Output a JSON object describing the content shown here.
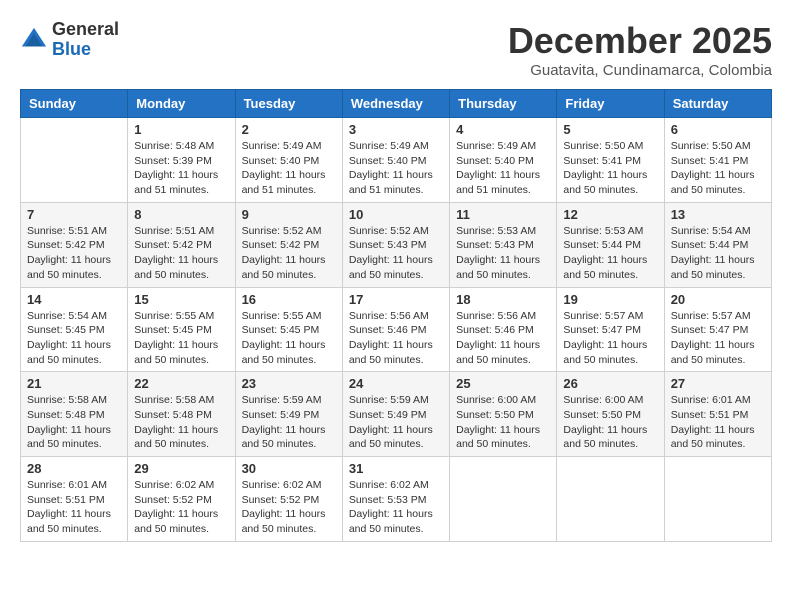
{
  "logo": {
    "general": "General",
    "blue": "Blue"
  },
  "title": "December 2025",
  "location": "Guatavita, Cundinamarca, Colombia",
  "weekdays": [
    "Sunday",
    "Monday",
    "Tuesday",
    "Wednesday",
    "Thursday",
    "Friday",
    "Saturday"
  ],
  "weeks": [
    [
      {
        "day": "",
        "info": ""
      },
      {
        "day": "1",
        "info": "Sunrise: 5:48 AM\nSunset: 5:39 PM\nDaylight: 11 hours\nand 51 minutes."
      },
      {
        "day": "2",
        "info": "Sunrise: 5:49 AM\nSunset: 5:40 PM\nDaylight: 11 hours\nand 51 minutes."
      },
      {
        "day": "3",
        "info": "Sunrise: 5:49 AM\nSunset: 5:40 PM\nDaylight: 11 hours\nand 51 minutes."
      },
      {
        "day": "4",
        "info": "Sunrise: 5:49 AM\nSunset: 5:40 PM\nDaylight: 11 hours\nand 51 minutes."
      },
      {
        "day": "5",
        "info": "Sunrise: 5:50 AM\nSunset: 5:41 PM\nDaylight: 11 hours\nand 50 minutes."
      },
      {
        "day": "6",
        "info": "Sunrise: 5:50 AM\nSunset: 5:41 PM\nDaylight: 11 hours\nand 50 minutes."
      }
    ],
    [
      {
        "day": "7",
        "info": "Sunrise: 5:51 AM\nSunset: 5:42 PM\nDaylight: 11 hours\nand 50 minutes."
      },
      {
        "day": "8",
        "info": "Sunrise: 5:51 AM\nSunset: 5:42 PM\nDaylight: 11 hours\nand 50 minutes."
      },
      {
        "day": "9",
        "info": "Sunrise: 5:52 AM\nSunset: 5:42 PM\nDaylight: 11 hours\nand 50 minutes."
      },
      {
        "day": "10",
        "info": "Sunrise: 5:52 AM\nSunset: 5:43 PM\nDaylight: 11 hours\nand 50 minutes."
      },
      {
        "day": "11",
        "info": "Sunrise: 5:53 AM\nSunset: 5:43 PM\nDaylight: 11 hours\nand 50 minutes."
      },
      {
        "day": "12",
        "info": "Sunrise: 5:53 AM\nSunset: 5:44 PM\nDaylight: 11 hours\nand 50 minutes."
      },
      {
        "day": "13",
        "info": "Sunrise: 5:54 AM\nSunset: 5:44 PM\nDaylight: 11 hours\nand 50 minutes."
      }
    ],
    [
      {
        "day": "14",
        "info": "Sunrise: 5:54 AM\nSunset: 5:45 PM\nDaylight: 11 hours\nand 50 minutes."
      },
      {
        "day": "15",
        "info": "Sunrise: 5:55 AM\nSunset: 5:45 PM\nDaylight: 11 hours\nand 50 minutes."
      },
      {
        "day": "16",
        "info": "Sunrise: 5:55 AM\nSunset: 5:45 PM\nDaylight: 11 hours\nand 50 minutes."
      },
      {
        "day": "17",
        "info": "Sunrise: 5:56 AM\nSunset: 5:46 PM\nDaylight: 11 hours\nand 50 minutes."
      },
      {
        "day": "18",
        "info": "Sunrise: 5:56 AM\nSunset: 5:46 PM\nDaylight: 11 hours\nand 50 minutes."
      },
      {
        "day": "19",
        "info": "Sunrise: 5:57 AM\nSunset: 5:47 PM\nDaylight: 11 hours\nand 50 minutes."
      },
      {
        "day": "20",
        "info": "Sunrise: 5:57 AM\nSunset: 5:47 PM\nDaylight: 11 hours\nand 50 minutes."
      }
    ],
    [
      {
        "day": "21",
        "info": "Sunrise: 5:58 AM\nSunset: 5:48 PM\nDaylight: 11 hours\nand 50 minutes."
      },
      {
        "day": "22",
        "info": "Sunrise: 5:58 AM\nSunset: 5:48 PM\nDaylight: 11 hours\nand 50 minutes."
      },
      {
        "day": "23",
        "info": "Sunrise: 5:59 AM\nSunset: 5:49 PM\nDaylight: 11 hours\nand 50 minutes."
      },
      {
        "day": "24",
        "info": "Sunrise: 5:59 AM\nSunset: 5:49 PM\nDaylight: 11 hours\nand 50 minutes."
      },
      {
        "day": "25",
        "info": "Sunrise: 6:00 AM\nSunset: 5:50 PM\nDaylight: 11 hours\nand 50 minutes."
      },
      {
        "day": "26",
        "info": "Sunrise: 6:00 AM\nSunset: 5:50 PM\nDaylight: 11 hours\nand 50 minutes."
      },
      {
        "day": "27",
        "info": "Sunrise: 6:01 AM\nSunset: 5:51 PM\nDaylight: 11 hours\nand 50 minutes."
      }
    ],
    [
      {
        "day": "28",
        "info": "Sunrise: 6:01 AM\nSunset: 5:51 PM\nDaylight: 11 hours\nand 50 minutes."
      },
      {
        "day": "29",
        "info": "Sunrise: 6:02 AM\nSunset: 5:52 PM\nDaylight: 11 hours\nand 50 minutes."
      },
      {
        "day": "30",
        "info": "Sunrise: 6:02 AM\nSunset: 5:52 PM\nDaylight: 11 hours\nand 50 minutes."
      },
      {
        "day": "31",
        "info": "Sunrise: 6:02 AM\nSunset: 5:53 PM\nDaylight: 11 hours\nand 50 minutes."
      },
      {
        "day": "",
        "info": ""
      },
      {
        "day": "",
        "info": ""
      },
      {
        "day": "",
        "info": ""
      }
    ]
  ]
}
